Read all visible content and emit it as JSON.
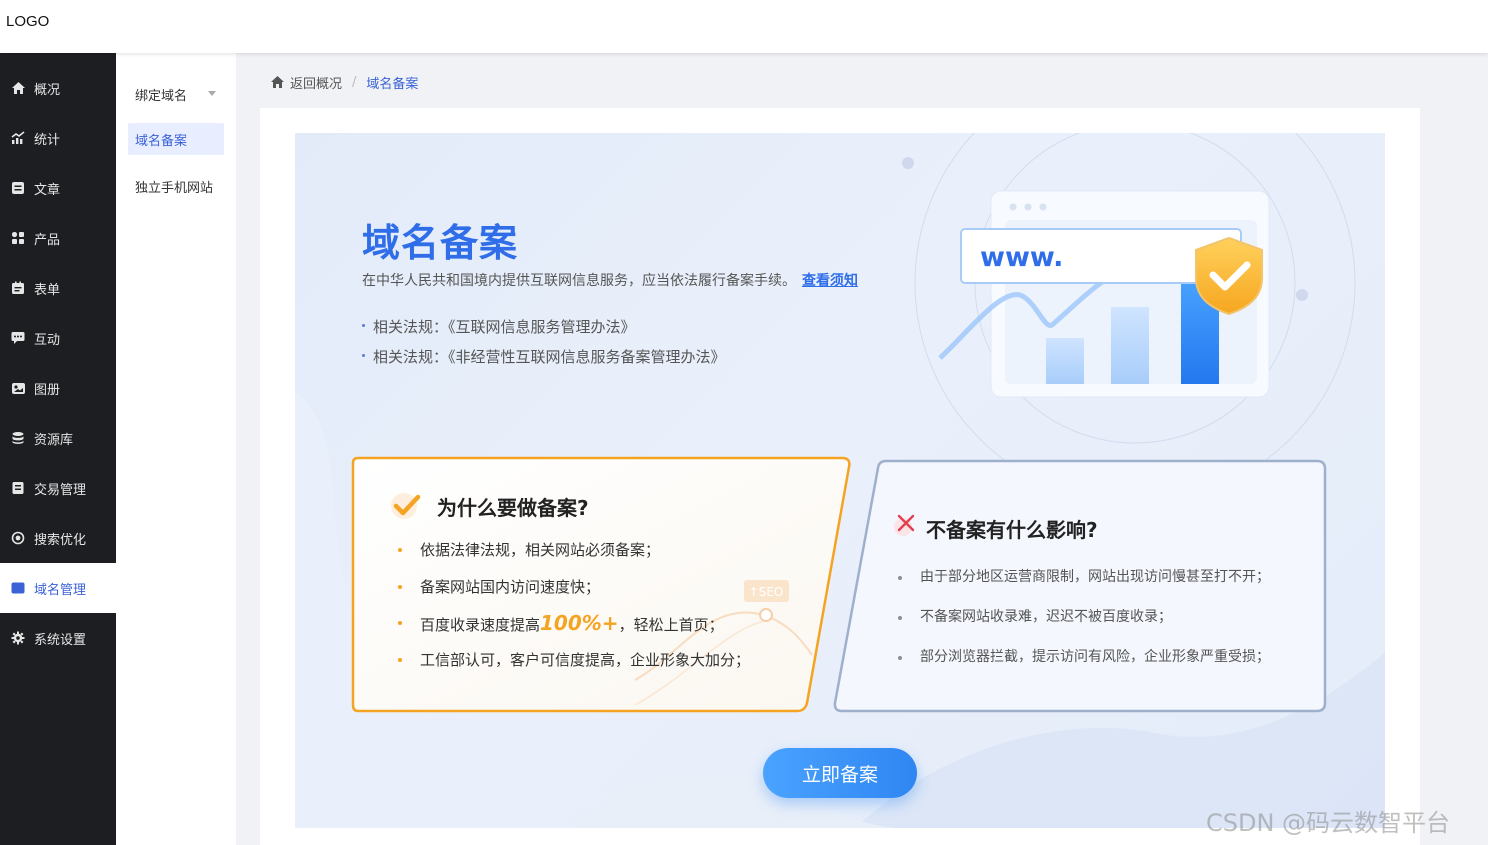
{
  "header": {
    "logo": "LOGO"
  },
  "nav": {
    "items": [
      {
        "label": "概况",
        "icon": "home-icon"
      },
      {
        "label": "统计",
        "icon": "chart-icon"
      },
      {
        "label": "文章",
        "icon": "article-icon"
      },
      {
        "label": "产品",
        "icon": "grid-icon"
      },
      {
        "label": "表单",
        "icon": "clipboard-icon"
      },
      {
        "label": "互动",
        "icon": "chat-icon"
      },
      {
        "label": "图册",
        "icon": "album-icon"
      },
      {
        "label": "资源库",
        "icon": "database-icon"
      },
      {
        "label": "交易管理",
        "icon": "receipt-icon"
      },
      {
        "label": "搜索优化",
        "icon": "target-icon"
      },
      {
        "label": "域名管理",
        "icon": "w-badge-icon",
        "active": true
      },
      {
        "label": "系统设置",
        "icon": "gear-icon"
      }
    ]
  },
  "subnav": {
    "items": [
      {
        "label": "绑定域名",
        "has_caret": true
      },
      {
        "label": "域名备案",
        "active": true
      },
      {
        "label": "独立手机网站"
      }
    ]
  },
  "breadcrumb": {
    "back": "返回概况",
    "sep": "/",
    "current": "域名备案"
  },
  "hero": {
    "title": "域名备案",
    "desc": "在中华人民共和国境内提供互联网信息服务，应当依法履行备案手续。",
    "link": "查看须知",
    "laws": [
      "相关法规：《互联网信息服务管理办法》",
      "相关法规：《非经营性互联网信息服务备案管理办法》"
    ],
    "illustration": {
      "www": "www.",
      "seo_tag": "↑SEO"
    }
  },
  "why_card": {
    "title": "为什么要做备案?",
    "items": [
      {
        "text": "依据法律法规，相关网站必须备案；"
      },
      {
        "text": "备案网站国内访问速度快；"
      },
      {
        "pre": "百度收录速度提高",
        "highlight": "100%+",
        "post": "，轻松上首页；"
      },
      {
        "text": "工信部认可，客户可信度提高，企业形象大加分；"
      }
    ]
  },
  "no_card": {
    "title": "不备案有什么影响?",
    "items": [
      "由于部分地区运营商限制，网站出现访问慢甚至打不开；",
      "不备案网站收录难，迟迟不被百度收录；",
      "部分浏览器拦截，提示访问有风险，企业形象严重受损；"
    ]
  },
  "cta": {
    "label": "立即备案"
  },
  "watermark": "CSDN @码云数智平台",
  "colors": {
    "nav_bg": "#1d1e22",
    "accent": "#3b62d6",
    "title_blue": "#2f6ee8",
    "orange": "#f5a323",
    "gray_border": "#9fb0cc"
  }
}
